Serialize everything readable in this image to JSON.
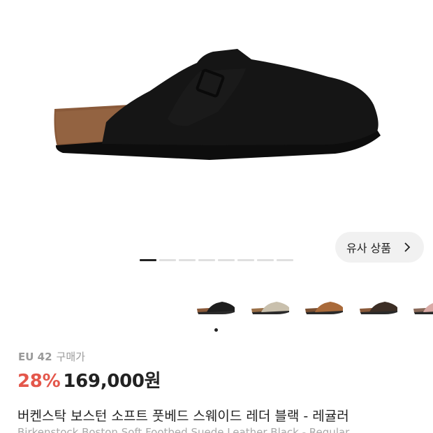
{
  "similar_button": {
    "label": "유사 상품"
  },
  "pager": {
    "count": 8,
    "active_index": 0
  },
  "thumbnails": [
    {
      "color_name": "black",
      "color": "#1e1e1e",
      "sole": "#8a5a3a"
    },
    {
      "color_name": "taupe",
      "color": "#c9c0ad",
      "sole": "#9a7048"
    },
    {
      "color_name": "mink",
      "color": "#a96a3a",
      "sole": "#7b5032"
    },
    {
      "color_name": "dark-brown",
      "color": "#3c2e25",
      "sole": "#8a5a3a"
    },
    {
      "color_name": "pink",
      "color": "#d9aaa6",
      "sole": "#8a6a5a"
    }
  ],
  "product": {
    "size": "EU 42",
    "price_type": "구매가",
    "discount": "28%",
    "price": "169,000원",
    "title_ko": "버켄스탁 보스턴 소프트 풋베드 스웨이드 레더 블랙 - 레귤러",
    "title_en": "Birkenstock Boston Soft Footbed Suede Leather Black - Regular"
  },
  "colors": {
    "discount": "#e4574b",
    "text": "#222222",
    "muted": "#9a9a9a",
    "button_bg": "#f1f1f1"
  }
}
